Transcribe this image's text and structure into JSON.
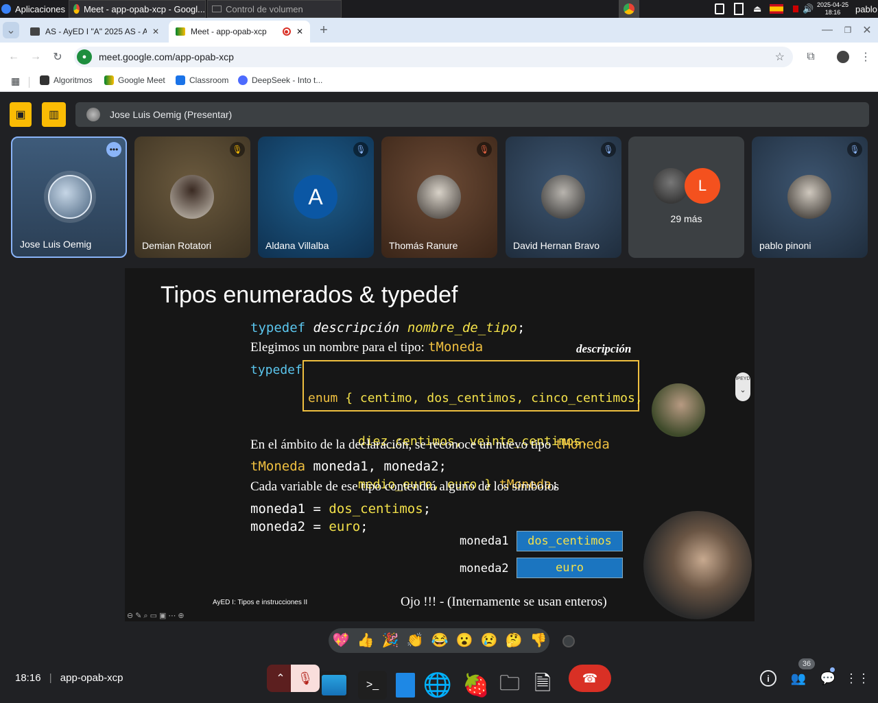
{
  "os": {
    "apps_label": "Aplicaciones",
    "task1": "Meet - app-opab-xcp - Googl...",
    "task2": "Control de volumen",
    "date": "2025-04-25",
    "time": "18:16",
    "user": "pablo"
  },
  "browser": {
    "tabs": [
      {
        "label": "AS - AyED I \"A\" 2025 AS - Al"
      },
      {
        "label": "Meet - app-opab-xcp"
      }
    ],
    "url": "meet.google.com/app-opab-xcp",
    "bookmarks": [
      "Algoritmos",
      "Google Meet",
      "Classroom",
      "DeepSeek - Into t..."
    ]
  },
  "meet": {
    "presenter_label": "Jose Luis Oemig (Presentar)",
    "participants": [
      {
        "name": "Jose Luis Oemig"
      },
      {
        "name": "Demian Rotatori"
      },
      {
        "name": "Aldana Villalba",
        "initial": "A"
      },
      {
        "name": "Thomás Ranure"
      },
      {
        "name": "David Hernan Bravo"
      },
      {
        "more": "29 más",
        "initial": "L"
      },
      {
        "name": "pablo pinoni"
      }
    ],
    "meeting_time": "18:16",
    "meeting_code": "app-opab-xcp",
    "people_count": "36",
    "colors": {
      "accent": "#fbbc04",
      "end_call": "#d93025",
      "highlight": "#8ab4f8"
    }
  },
  "slide": {
    "title": "Tipos enumerados & typedef",
    "l1_kw": "typedef",
    "l1_desc": "descripción",
    "l1_name": "nombre_de_tipo",
    "l1_semi": ";",
    "l2_text": "Elegimos un nombre para el tipo:",
    "l2_type": "tMoneda",
    "desc_label": "descripción",
    "enum_kw": "typedef",
    "enum_word": "enum",
    "enum_l1": "{ centimo, dos_centimos, cinco_centimos,",
    "enum_l2": "diez_centimos, veinte_centimos,",
    "enum_l3": "medio_euro, euro }",
    "enum_type": "tMoneda",
    "enum_semi": ";",
    "p1_text": "En el ámbito de la declaración, se reconoce un nuevo tipo",
    "p1_type": "tMoneda",
    "decl_type": "tMoneda",
    "decl_rest": "moneda1, moneda2;",
    "p2_text": "Cada variable de ese tipo contendrá alguno de los símbolos",
    "a1_var": "moneda1 =",
    "a1_val": "dos_centimos",
    "a2_var": "moneda2 =",
    "a2_val": "euro",
    "semi": ";",
    "box1_label": "moneda1",
    "box1_value": "dos_centimos",
    "box2_label": "moneda2",
    "box2_value": "euro",
    "footer_left": "AyED I: Tipos e instrucciones II",
    "footer_right": "Ojo !!! - (Internamente se usan enteros)",
    "badge": "IPEYD"
  },
  "reactions": [
    "💖",
    "👍",
    "🎉",
    "👏",
    "😂",
    "😮",
    "😢",
    "🤔",
    "👎"
  ]
}
